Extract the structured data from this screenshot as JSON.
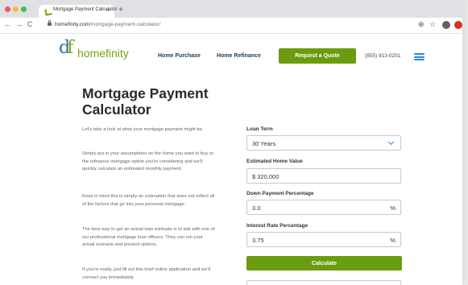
{
  "browser": {
    "tab_title": "Mortgage Payment Calculator",
    "tab_close": "×",
    "new_tab": "+",
    "url_host": "homefinity.com",
    "url_path": "/mortgage-payment-calculator/",
    "back": "←",
    "forward": "→",
    "reload": "C",
    "zoom_icon": "⊕",
    "star_icon": "☆"
  },
  "header": {
    "logo_mark_a": "d",
    "logo_mark_b": "f",
    "logo_text": "homefinity",
    "nav": [
      "Home Purchase",
      "Home Refinance"
    ],
    "quote_button": "Request a Quote",
    "phone": "(855) 913-0251"
  },
  "main": {
    "title": "Mortgage Payment Calculator",
    "paragraphs": [
      "Let's take a look at what your mortgage payment might be.",
      "Simply put in your assumptions on the home you want to buy or the refinance mortgage option you're considering and we'll quickly calculate an estimated monthly payment.",
      "Keep in mind this is simply an estimation that does not reflect all of the factors that go into your personal mortgage.",
      "The best way to get an actual loan estimate is to talk with one of our professional mortgage loan officers. They can run your actual scenario and present options.",
      "If you're ready, just fill out this brief online application and we'll connect you immediately."
    ]
  },
  "form": {
    "loan_term_label": "Loan Term",
    "loan_term_value": "30 Years",
    "home_value_label": "Estimated Home Value",
    "home_value": "$ 320,000",
    "down_payment_label": "Down Payment Percentage",
    "down_payment_value": "3.0",
    "interest_label": "Interest Rate Percentage",
    "interest_value": "3.75",
    "percent_symbol": "%",
    "calculate_button": "Calculate"
  },
  "colors": {
    "brand_green": "#6a9c0f",
    "brand_blue": "#2b87d8",
    "nav_text": "#213c5a"
  }
}
